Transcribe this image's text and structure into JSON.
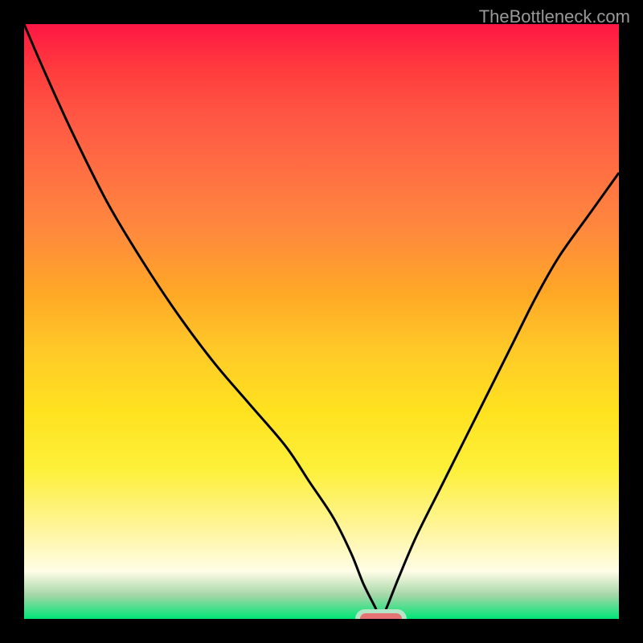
{
  "watermark": "TheBottleneck.com",
  "chart_data": {
    "type": "line",
    "title": "",
    "xlabel": "",
    "ylabel": "",
    "x_range": [
      0,
      100
    ],
    "y_range": [
      0,
      100
    ],
    "curve_points": {
      "x": [
        0,
        3,
        8,
        14,
        20,
        26,
        32,
        38,
        44,
        48,
        52,
        55,
        57,
        59,
        60,
        61,
        63,
        66,
        70,
        74,
        78,
        82,
        86,
        90,
        95,
        100
      ],
      "y": [
        100,
        93,
        82,
        70,
        60,
        51,
        43,
        36,
        29,
        23,
        17,
        11,
        6,
        2,
        0,
        2,
        7,
        14,
        22,
        30,
        38,
        46,
        54,
        61,
        68,
        75
      ]
    },
    "marker": {
      "x": 60,
      "y": 0,
      "width": 7,
      "color": "#e57373"
    },
    "gradient_stops": [
      {
        "pos": 0,
        "color": "#ff1744"
      },
      {
        "pos": 50,
        "color": "#ffca28"
      },
      {
        "pos": 95,
        "color": "#fffde7"
      },
      {
        "pos": 100,
        "color": "#00e676"
      }
    ]
  }
}
